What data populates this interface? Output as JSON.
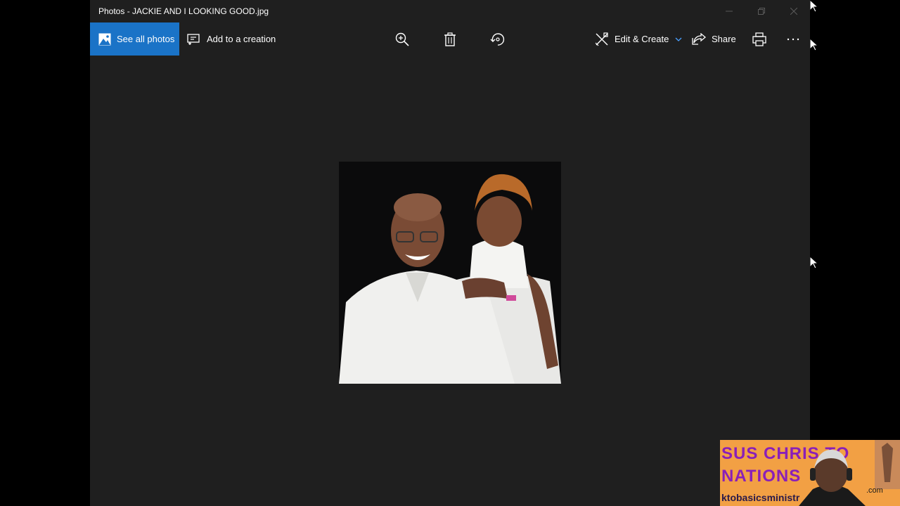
{
  "window": {
    "title": "Photos - JACKIE AND I LOOKING GOOD.jpg"
  },
  "toolbar": {
    "see_all_photos": "See all photos",
    "add_to_creation": "Add to a creation",
    "edit_create": "Edit & Create",
    "share": "Share"
  },
  "webcam": {
    "line1": "SUS CHRIS  TO",
    "line2": "NATIONS",
    "line3": "ktobasicsministr",
    "line4": ".com"
  },
  "colors": {
    "accent": "#1a73c7",
    "background": "#1f1f1f",
    "chevron": "#4aa0ff"
  },
  "icons": [
    "image-icon",
    "add-creation-icon",
    "zoom-in-icon",
    "delete-icon",
    "rotate-icon",
    "edit-create-icon",
    "chevron-down-icon",
    "share-icon",
    "print-icon",
    "more-icon",
    "minimize-icon",
    "restore-icon",
    "close-icon"
  ]
}
